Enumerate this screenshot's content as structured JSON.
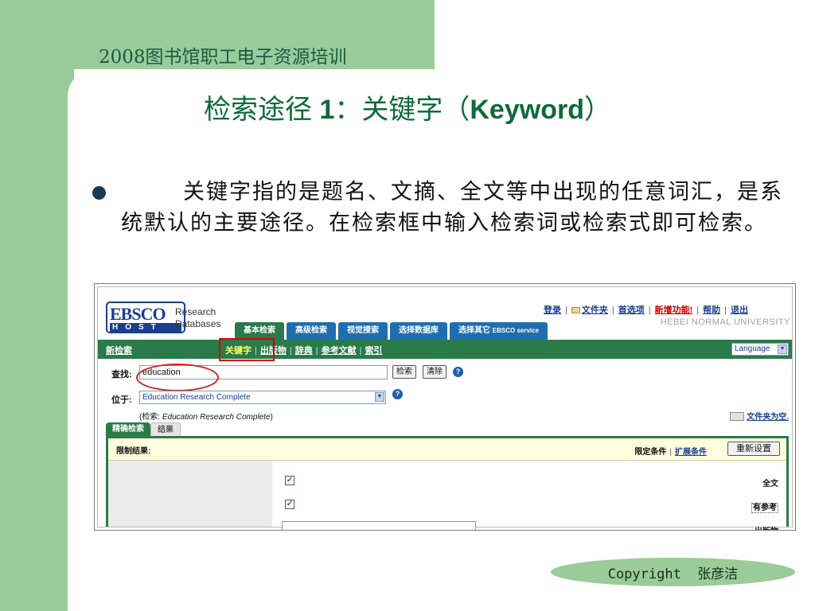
{
  "slide": {
    "course_title": "2008图书馆职工电子资源培训",
    "title_prefix": "检索途径",
    "title_num": " 1",
    "title_colon": "：关键字（",
    "title_keyword": "Keyword",
    "title_close": "）",
    "bullet_text": "关键字指的是题名、文摘、全文等中出现的任意词汇，是系统默认的主要途径。在检索框中输入检索词或检索式即可检索。",
    "copyright": "Copyright  张彦洁"
  },
  "ebsco": {
    "logo_main": "EBSCO",
    "logo_host": "HOST",
    "logo_research": "Research",
    "logo_databases": "Databases",
    "top_links": {
      "login": "登录",
      "folder": "文件夹",
      "preferences": "首选项",
      "new_features": "新增功能!",
      "help": "帮助",
      "exit": "退出"
    },
    "university": "HEBEI NORMAL UNIVERSITY",
    "tabs": [
      "基本检索",
      "高级检索",
      "视觉搜索",
      "选择数据库"
    ],
    "tab_other": "选择其它",
    "tab_other_small": "EBSCO service",
    "new_search": "新检索",
    "subnav": {
      "keyword": "关键字",
      "publications": "出版物",
      "dictionary": "辞典",
      "references": "参考文献",
      "index": "索引"
    },
    "language": "Language",
    "find_label": "查找:",
    "search_value": "education",
    "search_button": "检索",
    "clear_button": "清除",
    "in_label": "位于:",
    "database": "Education Research Complete",
    "searching_prefix": "(检索: ",
    "searching_db": "Education Research Complete",
    "searching_suffix": ")",
    "empty_folder": "文件夹为空.",
    "refine_tab": "精确检索",
    "results_tab": "结果",
    "limit_title": "限制结果:",
    "limiters_label": "限定条件",
    "expanders_link": "扩展条件",
    "reset_button": "重新设置",
    "fulltext_label": "全文",
    "refs_label": "有参考",
    "publication_label": "出版物",
    "fulltext_checked": true,
    "refs_checked": true
  },
  "colors": {
    "slide_green": "#99cc99",
    "title_green": "#0e6a3a",
    "ebsco_green": "#2a7a4a",
    "ebsco_blue": "#1f6fb0",
    "highlight_red": "#e00000"
  }
}
